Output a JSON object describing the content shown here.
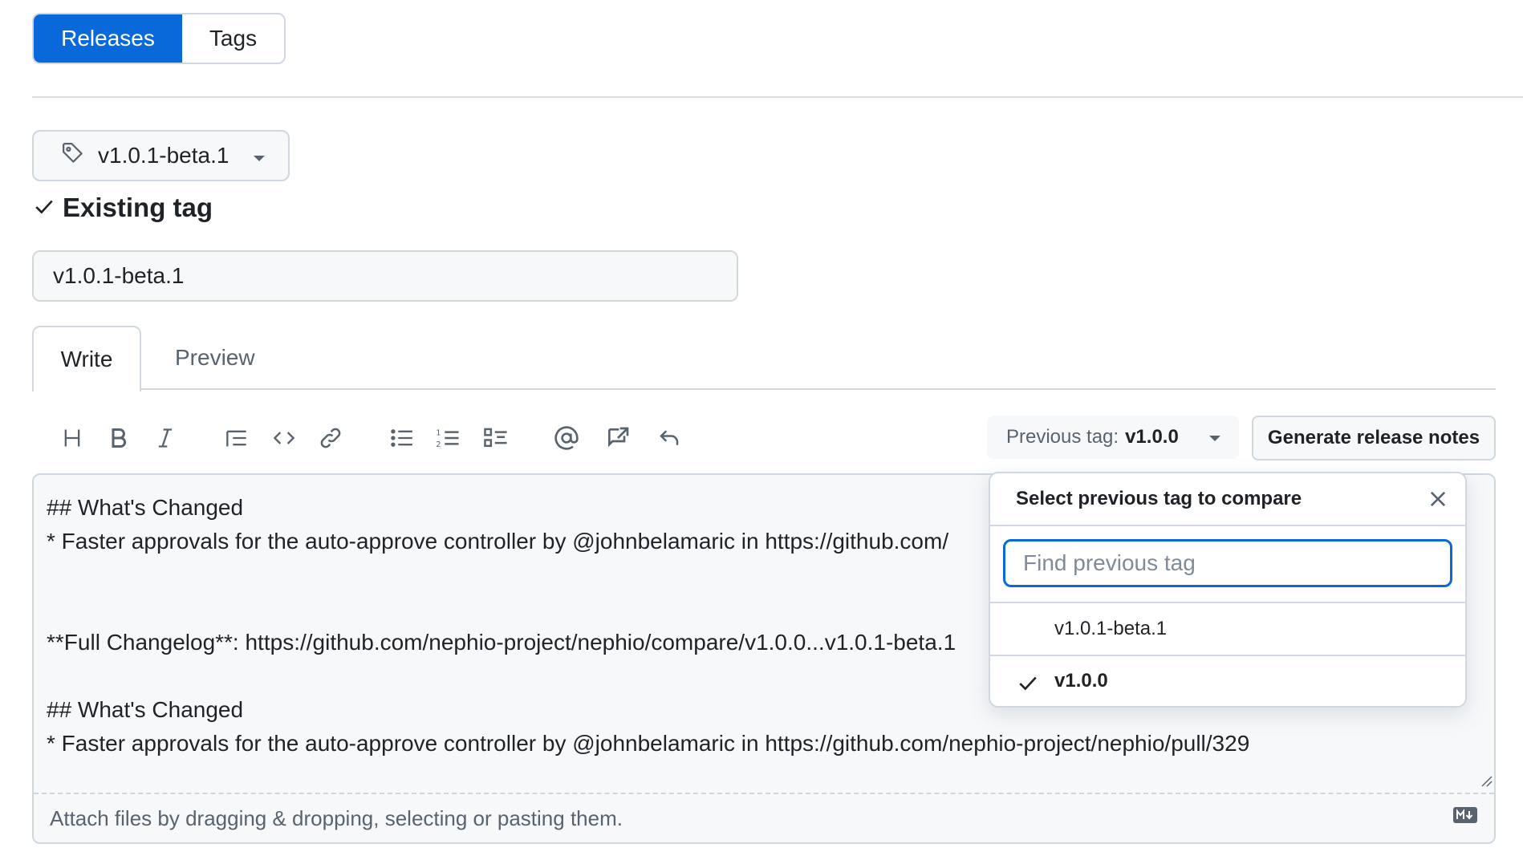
{
  "segmented": {
    "releases": "Releases",
    "tags": "Tags"
  },
  "tag_select": {
    "value": "v1.0.1-beta.1"
  },
  "existing_tag_label": "Existing tag",
  "release_title": {
    "value": "v1.0.1-beta.1"
  },
  "tabs": {
    "write": "Write",
    "preview": "Preview"
  },
  "toolbar": {
    "icons": [
      "heading-icon",
      "bold-icon",
      "italic-icon",
      "quote-icon",
      "code-icon",
      "link-icon",
      "unordered-list-icon",
      "ordered-list-icon",
      "task-list-icon",
      "mention-icon",
      "reference-icon",
      "undo-icon"
    ],
    "previous_tag_label": "Previous tag:",
    "previous_tag_value": "v1.0.0",
    "generate_label": "Generate release notes"
  },
  "editor": {
    "lines": [
      "## What's Changed",
      "* Faster approvals for the auto-approve controller by @johnbelamaric in https://github.com/",
      "",
      "",
      "**Full Changelog**: https://github.com/nephio-project/nephio/compare/v1.0.0...v1.0.1-beta.1",
      "",
      "## What's Changed",
      "* Faster approvals for the auto-approve controller by @johnbelamaric in https://github.com/nephio-project/nephio/pull/329"
    ],
    "footer": "Attach files by dragging & dropping, selecting or pasting them."
  },
  "popover": {
    "title": "Select previous tag to compare",
    "search_placeholder": "Find previous tag",
    "items": [
      {
        "label": "v1.0.1-beta.1",
        "selected": false
      },
      {
        "label": "v1.0.0",
        "selected": true
      }
    ]
  },
  "colors": {
    "accent": "#0969da",
    "border": "#d0d7de",
    "muted": "#59636e"
  }
}
